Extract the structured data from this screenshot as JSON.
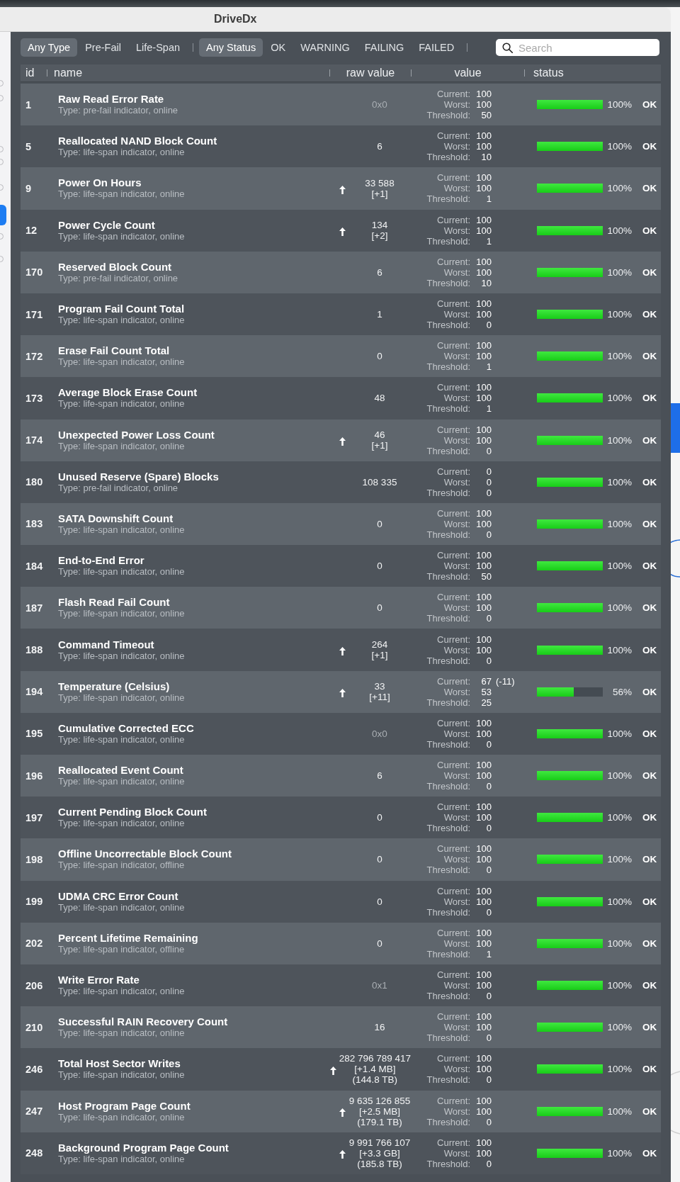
{
  "window": {
    "title": "DriveDx"
  },
  "filters": {
    "type": [
      {
        "label": "Any Type",
        "selected": true
      },
      {
        "label": "Pre-Fail",
        "selected": false
      },
      {
        "label": "Life-Span",
        "selected": false
      }
    ],
    "status": [
      {
        "label": "Any Status",
        "selected": true
      },
      {
        "label": "OK",
        "selected": false
      },
      {
        "label": "WARNING",
        "selected": false
      },
      {
        "label": "FAILING",
        "selected": false
      },
      {
        "label": "FAILED",
        "selected": false
      }
    ]
  },
  "search": {
    "placeholder": "Search"
  },
  "table": {
    "columns": [
      "id",
      "name",
      "raw value",
      "value",
      "status"
    ],
    "rows": [
      {
        "id": "1",
        "name": "Raw Read Error Rate",
        "type": "Type: pre-fail indicator, online",
        "trend_up": false,
        "raw": [
          "0x0"
        ],
        "raw_muted": true,
        "values": [
          {
            "label": "Current:",
            "value": "100"
          },
          {
            "label": "Worst:",
            "value": "100"
          },
          {
            "label": "Threshold:",
            "value": "50"
          }
        ],
        "level": 1,
        "percent": "100%",
        "status": "OK"
      },
      {
        "id": "5",
        "name": "Reallocated NAND Block Count",
        "type": "Type: life-span indicator, online",
        "trend_up": false,
        "raw": [
          "6"
        ],
        "raw_muted": false,
        "values": [
          {
            "label": "Current:",
            "value": "100"
          },
          {
            "label": "Worst:",
            "value": "100"
          },
          {
            "label": "Threshold:",
            "value": "10"
          }
        ],
        "level": 1,
        "percent": "100%",
        "status": "OK"
      },
      {
        "id": "9",
        "name": "Power On Hours",
        "type": "Type: life-span indicator, online",
        "trend_up": true,
        "raw": [
          "33 588",
          "[+1]"
        ],
        "raw_muted": false,
        "values": [
          {
            "label": "Current:",
            "value": "100"
          },
          {
            "label": "Worst:",
            "value": "100"
          },
          {
            "label": "Threshold:",
            "value": "1"
          }
        ],
        "level": 1,
        "percent": "100%",
        "status": "OK"
      },
      {
        "id": "12",
        "name": "Power Cycle Count",
        "type": "Type: life-span indicator, online",
        "trend_up": true,
        "raw": [
          "134",
          "[+2]"
        ],
        "raw_muted": false,
        "values": [
          {
            "label": "Current:",
            "value": "100"
          },
          {
            "label": "Worst:",
            "value": "100"
          },
          {
            "label": "Threshold:",
            "value": "1"
          }
        ],
        "level": 1,
        "percent": "100%",
        "status": "OK"
      },
      {
        "id": "170",
        "name": "Reserved Block Count",
        "type": "Type: pre-fail indicator, online",
        "trend_up": false,
        "raw": [
          "6"
        ],
        "raw_muted": false,
        "values": [
          {
            "label": "Current:",
            "value": "100"
          },
          {
            "label": "Worst:",
            "value": "100"
          },
          {
            "label": "Threshold:",
            "value": "10"
          }
        ],
        "level": 1,
        "percent": "100%",
        "status": "OK"
      },
      {
        "id": "171",
        "name": "Program Fail Count Total",
        "type": "Type: life-span indicator, online",
        "trend_up": false,
        "raw": [
          "1"
        ],
        "raw_muted": false,
        "values": [
          {
            "label": "Current:",
            "value": "100"
          },
          {
            "label": "Worst:",
            "value": "100"
          },
          {
            "label": "Threshold:",
            "value": "0"
          }
        ],
        "level": 1,
        "percent": "100%",
        "status": "OK"
      },
      {
        "id": "172",
        "name": "Erase Fail Count Total",
        "type": "Type: life-span indicator, online",
        "trend_up": false,
        "raw": [
          "0"
        ],
        "raw_muted": false,
        "values": [
          {
            "label": "Current:",
            "value": "100"
          },
          {
            "label": "Worst:",
            "value": "100"
          },
          {
            "label": "Threshold:",
            "value": "1"
          }
        ],
        "level": 1,
        "percent": "100%",
        "status": "OK"
      },
      {
        "id": "173",
        "name": "Average Block Erase Count",
        "type": "Type: life-span indicator, online",
        "trend_up": false,
        "raw": [
          "48"
        ],
        "raw_muted": false,
        "values": [
          {
            "label": "Current:",
            "value": "100"
          },
          {
            "label": "Worst:",
            "value": "100"
          },
          {
            "label": "Threshold:",
            "value": "1"
          }
        ],
        "level": 1,
        "percent": "100%",
        "status": "OK"
      },
      {
        "id": "174",
        "name": "Unexpected Power Loss Count",
        "type": "Type: life-span indicator, online",
        "trend_up": true,
        "raw": [
          "46",
          "[+1]"
        ],
        "raw_muted": false,
        "values": [
          {
            "label": "Current:",
            "value": "100"
          },
          {
            "label": "Worst:",
            "value": "100"
          },
          {
            "label": "Threshold:",
            "value": "0"
          }
        ],
        "level": 1,
        "percent": "100%",
        "status": "OK"
      },
      {
        "id": "180",
        "name": "Unused Reserve (Spare) Blocks",
        "type": "Type: pre-fail indicator, online",
        "trend_up": false,
        "raw": [
          "108 335"
        ],
        "raw_muted": false,
        "values": [
          {
            "label": "Current:",
            "value": "0"
          },
          {
            "label": "Worst:",
            "value": "0"
          },
          {
            "label": "Threshold:",
            "value": "0"
          }
        ],
        "level": 1,
        "percent": "100%",
        "status": "OK"
      },
      {
        "id": "183",
        "name": "SATA Downshift Count",
        "type": "Type: life-span indicator, online",
        "trend_up": false,
        "raw": [
          "0"
        ],
        "raw_muted": false,
        "values": [
          {
            "label": "Current:",
            "value": "100"
          },
          {
            "label": "Worst:",
            "value": "100"
          },
          {
            "label": "Threshold:",
            "value": "0"
          }
        ],
        "level": 1,
        "percent": "100%",
        "status": "OK"
      },
      {
        "id": "184",
        "name": "End-to-End Error",
        "type": "Type: life-span indicator, online",
        "trend_up": false,
        "raw": [
          "0"
        ],
        "raw_muted": false,
        "values": [
          {
            "label": "Current:",
            "value": "100"
          },
          {
            "label": "Worst:",
            "value": "100"
          },
          {
            "label": "Threshold:",
            "value": "50"
          }
        ],
        "level": 1,
        "percent": "100%",
        "status": "OK"
      },
      {
        "id": "187",
        "name": "Flash Read Fail Count",
        "type": "Type: life-span indicator, online",
        "trend_up": false,
        "raw": [
          "0"
        ],
        "raw_muted": false,
        "values": [
          {
            "label": "Current:",
            "value": "100"
          },
          {
            "label": "Worst:",
            "value": "100"
          },
          {
            "label": "Threshold:",
            "value": "0"
          }
        ],
        "level": 1,
        "percent": "100%",
        "status": "OK"
      },
      {
        "id": "188",
        "name": "Command Timeout",
        "type": "Type: life-span indicator, online",
        "trend_up": true,
        "raw": [
          "264",
          "[+1]"
        ],
        "raw_muted": false,
        "values": [
          {
            "label": "Current:",
            "value": "100"
          },
          {
            "label": "Worst:",
            "value": "100"
          },
          {
            "label": "Threshold:",
            "value": "0"
          }
        ],
        "level": 1,
        "percent": "100%",
        "status": "OK"
      },
      {
        "id": "194",
        "name": "Temperature (Celsius)",
        "type": "Type: life-span indicator, online",
        "trend_up": true,
        "raw": [
          "33",
          "[+11]"
        ],
        "raw_muted": false,
        "values": [
          {
            "label": "Current:",
            "value": "67",
            "delta": "(-11)"
          },
          {
            "label": "Worst:",
            "value": "53"
          },
          {
            "label": "Threshold:",
            "value": "25"
          }
        ],
        "level": 0.56,
        "percent": "56%",
        "status": "OK"
      },
      {
        "id": "195",
        "name": "Cumulative Corrected ECC",
        "type": "Type: life-span indicator, online",
        "trend_up": false,
        "raw": [
          "0x0"
        ],
        "raw_muted": true,
        "values": [
          {
            "label": "Current:",
            "value": "100"
          },
          {
            "label": "Worst:",
            "value": "100"
          },
          {
            "label": "Threshold:",
            "value": "0"
          }
        ],
        "level": 1,
        "percent": "100%",
        "status": "OK"
      },
      {
        "id": "196",
        "name": "Reallocated Event Count",
        "type": "Type: life-span indicator, online",
        "trend_up": false,
        "raw": [
          "6"
        ],
        "raw_muted": false,
        "values": [
          {
            "label": "Current:",
            "value": "100"
          },
          {
            "label": "Worst:",
            "value": "100"
          },
          {
            "label": "Threshold:",
            "value": "0"
          }
        ],
        "level": 1,
        "percent": "100%",
        "status": "OK"
      },
      {
        "id": "197",
        "name": "Current Pending Block Count",
        "type": "Type: life-span indicator, online",
        "trend_up": false,
        "raw": [
          "0"
        ],
        "raw_muted": false,
        "values": [
          {
            "label": "Current:",
            "value": "100"
          },
          {
            "label": "Worst:",
            "value": "100"
          },
          {
            "label": "Threshold:",
            "value": "0"
          }
        ],
        "level": 1,
        "percent": "100%",
        "status": "OK"
      },
      {
        "id": "198",
        "name": "Offline Uncorrectable Block Count",
        "type": "Type: life-span indicator, offline",
        "trend_up": false,
        "raw": [
          "0"
        ],
        "raw_muted": false,
        "values": [
          {
            "label": "Current:",
            "value": "100"
          },
          {
            "label": "Worst:",
            "value": "100"
          },
          {
            "label": "Threshold:",
            "value": "0"
          }
        ],
        "level": 1,
        "percent": "100%",
        "status": "OK"
      },
      {
        "id": "199",
        "name": "UDMA CRC Error Count",
        "type": "Type: life-span indicator, online",
        "trend_up": false,
        "raw": [
          "0"
        ],
        "raw_muted": false,
        "values": [
          {
            "label": "Current:",
            "value": "100"
          },
          {
            "label": "Worst:",
            "value": "100"
          },
          {
            "label": "Threshold:",
            "value": "0"
          }
        ],
        "level": 1,
        "percent": "100%",
        "status": "OK"
      },
      {
        "id": "202",
        "name": "Percent Lifetime Remaining",
        "type": "Type: life-span indicator, offline",
        "trend_up": false,
        "raw": [
          "0"
        ],
        "raw_muted": false,
        "values": [
          {
            "label": "Current:",
            "value": "100"
          },
          {
            "label": "Worst:",
            "value": "100"
          },
          {
            "label": "Threshold:",
            "value": "1"
          }
        ],
        "level": 1,
        "percent": "100%",
        "status": "OK"
      },
      {
        "id": "206",
        "name": "Write Error Rate",
        "type": "Type: life-span indicator, online",
        "trend_up": false,
        "raw": [
          "0x1"
        ],
        "raw_muted": true,
        "values": [
          {
            "label": "Current:",
            "value": "100"
          },
          {
            "label": "Worst:",
            "value": "100"
          },
          {
            "label": "Threshold:",
            "value": "0"
          }
        ],
        "level": 1,
        "percent": "100%",
        "status": "OK"
      },
      {
        "id": "210",
        "name": "Successful RAIN Recovery Count",
        "type": "Type: life-span indicator, online",
        "trend_up": false,
        "raw": [
          "16"
        ],
        "raw_muted": false,
        "values": [
          {
            "label": "Current:",
            "value": "100"
          },
          {
            "label": "Worst:",
            "value": "100"
          },
          {
            "label": "Threshold:",
            "value": "0"
          }
        ],
        "level": 1,
        "percent": "100%",
        "status": "OK"
      },
      {
        "id": "246",
        "name": "Total Host Sector Writes",
        "type": "Type: life-span indicator, online",
        "trend_up": true,
        "raw": [
          "282 796 789 417",
          "[+1.4 MB]",
          "(144.8 TB)"
        ],
        "raw_muted": false,
        "values": [
          {
            "label": "Current:",
            "value": "100"
          },
          {
            "label": "Worst:",
            "value": "100"
          },
          {
            "label": "Threshold:",
            "value": "0"
          }
        ],
        "level": 1,
        "percent": "100%",
        "status": "OK"
      },
      {
        "id": "247",
        "name": "Host Program Page Count",
        "type": "Type: life-span indicator, online",
        "trend_up": true,
        "raw": [
          "9 635 126 855",
          "[+2.5 MB]",
          "(179.1 TB)"
        ],
        "raw_muted": false,
        "values": [
          {
            "label": "Current:",
            "value": "100"
          },
          {
            "label": "Worst:",
            "value": "100"
          },
          {
            "label": "Threshold:",
            "value": "0"
          }
        ],
        "level": 1,
        "percent": "100%",
        "status": "OK"
      },
      {
        "id": "248",
        "name": "Background Program Page Count",
        "type": "Type: life-span indicator, online",
        "trend_up": true,
        "raw": [
          "9 991 766 107",
          "[+3.3 GB]",
          "(185.8 TB)"
        ],
        "raw_muted": false,
        "values": [
          {
            "label": "Current:",
            "value": "100"
          },
          {
            "label": "Worst:",
            "value": "100"
          },
          {
            "label": "Threshold:",
            "value": "0"
          }
        ],
        "level": 1,
        "percent": "100%",
        "status": "OK"
      }
    ]
  }
}
